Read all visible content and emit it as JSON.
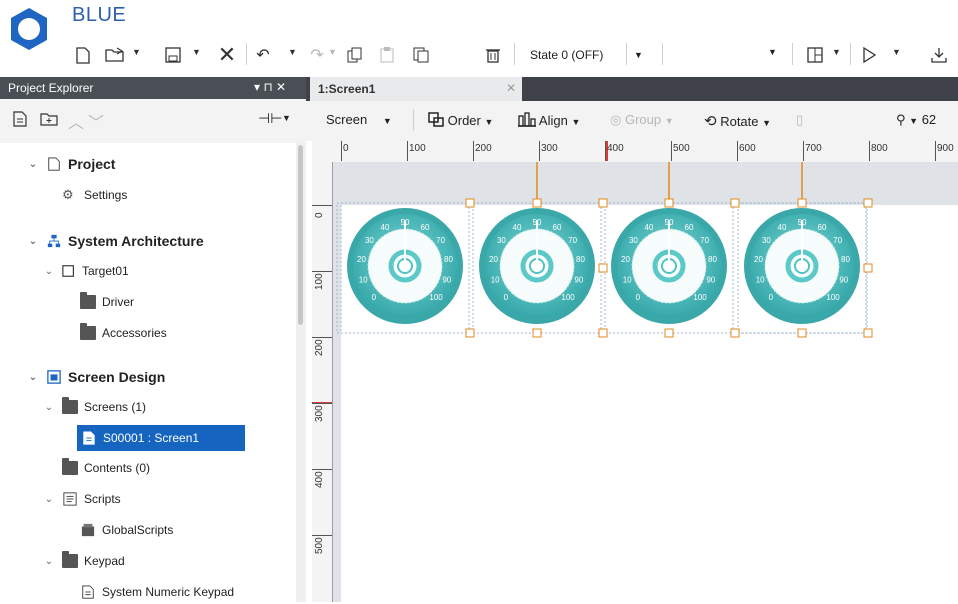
{
  "app": {
    "title": "BLUE",
    "brand_color": "#1f66c4"
  },
  "main_toolbar": {
    "state_select": "State 0 (OFF)",
    "icons": [
      "new-file-icon",
      "open-folder-icon",
      "save-icon",
      "delete-icon",
      "undo-icon",
      "redo-icon",
      "copy-icon",
      "paste-icon",
      "duplicate-icon",
      "trash-icon",
      "layout-icon",
      "run-icon",
      "download-icon"
    ]
  },
  "explorer": {
    "title": "Project Explorer",
    "header_controls": "▾ ⊓ ✕",
    "tree": {
      "project": "Project",
      "settings": "Settings",
      "system_architecture": "System Architecture",
      "target": "Target01",
      "driver": "Driver",
      "accessories": "Accessories",
      "screen_design": "Screen Design",
      "screens": "Screens (1)",
      "screen_item": "S00001 : Screen1",
      "contents": "Contents (0)",
      "scripts": "Scripts",
      "global_scripts": "GlobalScripts",
      "keypad": "Keypad",
      "numeric_keypad": "System Numeric Keypad"
    }
  },
  "editor": {
    "tab_label": "1:Screen1",
    "toolbar": {
      "screen": "Screen",
      "order": "Order",
      "align": "Align",
      "group": "Group",
      "rotate": "Rotate",
      "zoom_value": "62"
    },
    "ruler_top": [
      "0",
      "100",
      "200",
      "300",
      "400",
      "500",
      "600",
      "700",
      "800",
      "900"
    ],
    "ruler_left": [
      "0",
      "100",
      "200",
      "300",
      "400",
      "500"
    ]
  },
  "gauge_scale": [
    "0",
    "10",
    "20",
    "30",
    "40",
    "50",
    "60",
    "70",
    "80",
    "90",
    "100"
  ],
  "colors": {
    "gauge_teal": "#4fc3c3",
    "gauge_dark": "#3aa7a9",
    "selection_orange": "#e08a1e",
    "tree_selected": "#1565c0"
  }
}
